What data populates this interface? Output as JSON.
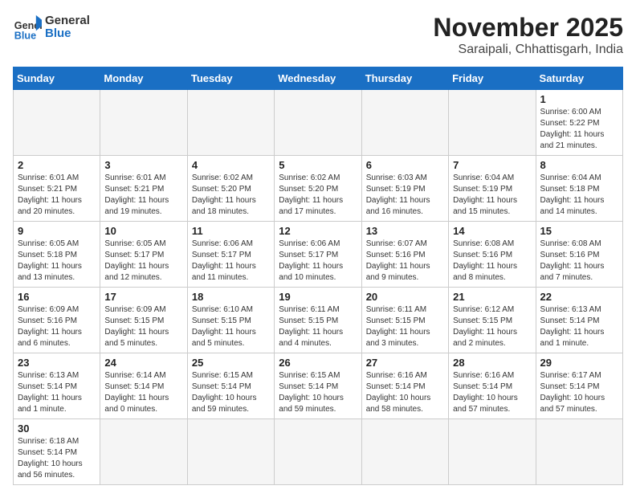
{
  "logo": {
    "text_general": "General",
    "text_blue": "Blue"
  },
  "header": {
    "month": "November 2025",
    "location": "Saraipali, Chhattisgarh, India"
  },
  "weekdays": [
    "Sunday",
    "Monday",
    "Tuesday",
    "Wednesday",
    "Thursday",
    "Friday",
    "Saturday"
  ],
  "days": [
    {
      "date": "",
      "info": ""
    },
    {
      "date": "",
      "info": ""
    },
    {
      "date": "",
      "info": ""
    },
    {
      "date": "",
      "info": ""
    },
    {
      "date": "",
      "info": ""
    },
    {
      "date": "",
      "info": ""
    },
    {
      "date": "1",
      "info": "Sunrise: 6:00 AM\nSunset: 5:22 PM\nDaylight: 11 hours\nand 21 minutes."
    },
    {
      "date": "2",
      "info": "Sunrise: 6:01 AM\nSunset: 5:21 PM\nDaylight: 11 hours\nand 20 minutes."
    },
    {
      "date": "3",
      "info": "Sunrise: 6:01 AM\nSunset: 5:21 PM\nDaylight: 11 hours\nand 19 minutes."
    },
    {
      "date": "4",
      "info": "Sunrise: 6:02 AM\nSunset: 5:20 PM\nDaylight: 11 hours\nand 18 minutes."
    },
    {
      "date": "5",
      "info": "Sunrise: 6:02 AM\nSunset: 5:20 PM\nDaylight: 11 hours\nand 17 minutes."
    },
    {
      "date": "6",
      "info": "Sunrise: 6:03 AM\nSunset: 5:19 PM\nDaylight: 11 hours\nand 16 minutes."
    },
    {
      "date": "7",
      "info": "Sunrise: 6:04 AM\nSunset: 5:19 PM\nDaylight: 11 hours\nand 15 minutes."
    },
    {
      "date": "8",
      "info": "Sunrise: 6:04 AM\nSunset: 5:18 PM\nDaylight: 11 hours\nand 14 minutes."
    },
    {
      "date": "9",
      "info": "Sunrise: 6:05 AM\nSunset: 5:18 PM\nDaylight: 11 hours\nand 13 minutes."
    },
    {
      "date": "10",
      "info": "Sunrise: 6:05 AM\nSunset: 5:17 PM\nDaylight: 11 hours\nand 12 minutes."
    },
    {
      "date": "11",
      "info": "Sunrise: 6:06 AM\nSunset: 5:17 PM\nDaylight: 11 hours\nand 11 minutes."
    },
    {
      "date": "12",
      "info": "Sunrise: 6:06 AM\nSunset: 5:17 PM\nDaylight: 11 hours\nand 10 minutes."
    },
    {
      "date": "13",
      "info": "Sunrise: 6:07 AM\nSunset: 5:16 PM\nDaylight: 11 hours\nand 9 minutes."
    },
    {
      "date": "14",
      "info": "Sunrise: 6:08 AM\nSunset: 5:16 PM\nDaylight: 11 hours\nand 8 minutes."
    },
    {
      "date": "15",
      "info": "Sunrise: 6:08 AM\nSunset: 5:16 PM\nDaylight: 11 hours\nand 7 minutes."
    },
    {
      "date": "16",
      "info": "Sunrise: 6:09 AM\nSunset: 5:16 PM\nDaylight: 11 hours\nand 6 minutes."
    },
    {
      "date": "17",
      "info": "Sunrise: 6:09 AM\nSunset: 5:15 PM\nDaylight: 11 hours\nand 5 minutes."
    },
    {
      "date": "18",
      "info": "Sunrise: 6:10 AM\nSunset: 5:15 PM\nDaylight: 11 hours\nand 5 minutes."
    },
    {
      "date": "19",
      "info": "Sunrise: 6:11 AM\nSunset: 5:15 PM\nDaylight: 11 hours\nand 4 minutes."
    },
    {
      "date": "20",
      "info": "Sunrise: 6:11 AM\nSunset: 5:15 PM\nDaylight: 11 hours\nand 3 minutes."
    },
    {
      "date": "21",
      "info": "Sunrise: 6:12 AM\nSunset: 5:15 PM\nDaylight: 11 hours\nand 2 minutes."
    },
    {
      "date": "22",
      "info": "Sunrise: 6:13 AM\nSunset: 5:14 PM\nDaylight: 11 hours\nand 1 minute."
    },
    {
      "date": "23",
      "info": "Sunrise: 6:13 AM\nSunset: 5:14 PM\nDaylight: 11 hours\nand 1 minute."
    },
    {
      "date": "24",
      "info": "Sunrise: 6:14 AM\nSunset: 5:14 PM\nDaylight: 11 hours\nand 0 minutes."
    },
    {
      "date": "25",
      "info": "Sunrise: 6:15 AM\nSunset: 5:14 PM\nDaylight: 10 hours\nand 59 minutes."
    },
    {
      "date": "26",
      "info": "Sunrise: 6:15 AM\nSunset: 5:14 PM\nDaylight: 10 hours\nand 59 minutes."
    },
    {
      "date": "27",
      "info": "Sunrise: 6:16 AM\nSunset: 5:14 PM\nDaylight: 10 hours\nand 58 minutes."
    },
    {
      "date": "28",
      "info": "Sunrise: 6:16 AM\nSunset: 5:14 PM\nDaylight: 10 hours\nand 57 minutes."
    },
    {
      "date": "29",
      "info": "Sunrise: 6:17 AM\nSunset: 5:14 PM\nDaylight: 10 hours\nand 57 minutes."
    },
    {
      "date": "30",
      "info": "Sunrise: 6:18 AM\nSunset: 5:14 PM\nDaylight: 10 hours\nand 56 minutes."
    },
    {
      "date": "",
      "info": ""
    },
    {
      "date": "",
      "info": ""
    },
    {
      "date": "",
      "info": ""
    },
    {
      "date": "",
      "info": ""
    },
    {
      "date": "",
      "info": ""
    },
    {
      "date": "",
      "info": ""
    }
  ]
}
